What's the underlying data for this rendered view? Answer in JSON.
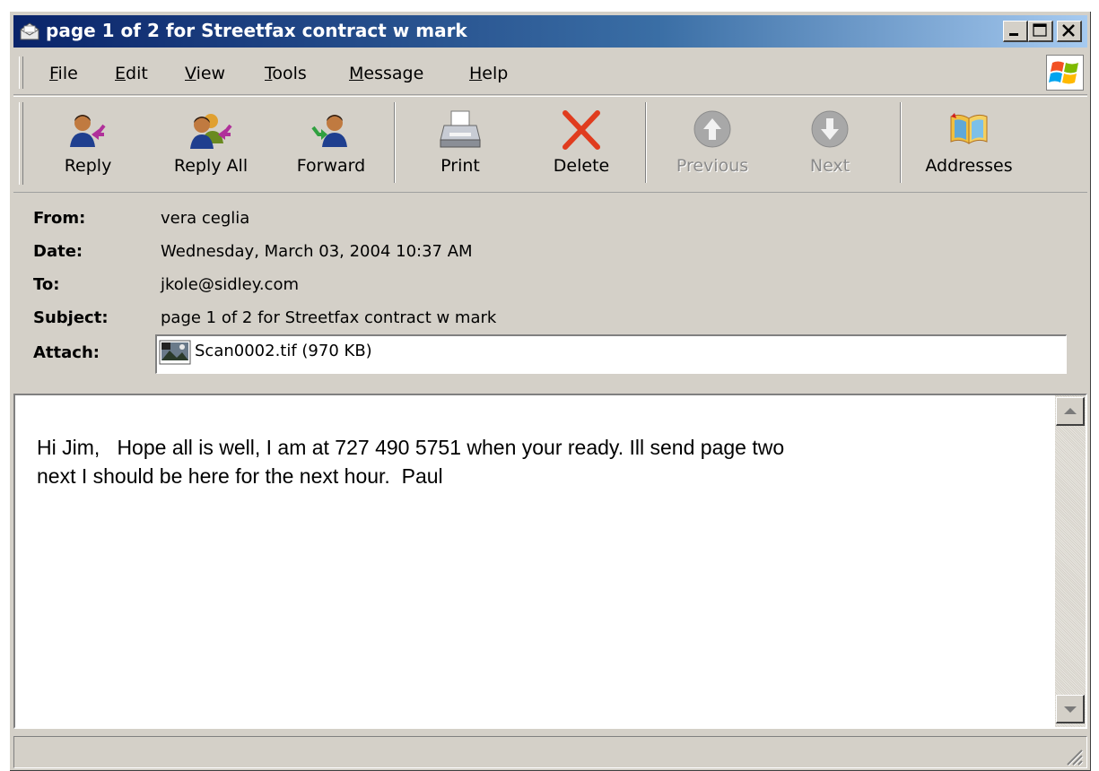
{
  "window": {
    "title": "page 1 of 2 for Streetfax contract w mark"
  },
  "menu": [
    {
      "label": "File",
      "key": "F",
      "rest": "ile"
    },
    {
      "label": "Edit",
      "key": "E",
      "rest": "dit"
    },
    {
      "label": "View",
      "key": "V",
      "rest": "iew"
    },
    {
      "label": "Tools",
      "key": "T",
      "rest": "ools"
    },
    {
      "label": "Message",
      "key": "M",
      "rest": "essage"
    },
    {
      "label": "Help",
      "key": "H",
      "rest": "elp"
    }
  ],
  "toolbar": {
    "reply": "Reply",
    "reply_all": "Reply All",
    "forward": "Forward",
    "print": "Print",
    "delete": "Delete",
    "previous": "Previous",
    "next": "Next",
    "addresses": "Addresses"
  },
  "headers": {
    "from_label": "From:",
    "from": "vera ceglia",
    "date_label": "Date:",
    "date": "Wednesday, March 03, 2004 10:37 AM",
    "to_label": "To:",
    "to": "jkole@sidley.com",
    "subject_label": "Subject:",
    "subject": "page 1 of 2 for Streetfax contract w mark",
    "attach_label": "Attach:",
    "attachment": "Scan0002.tif (970 KB)"
  },
  "body": {
    "line1": "Hi Jim,   Hope all is well, I am at 727 490 5751 when your ready. Ill send page two",
    "line2": "next I should be here for the next hour.  Paul"
  },
  "colors": {
    "titlebar_start": "#0a246a",
    "titlebar_end": "#a6caf0",
    "chrome": "#d4d0c8",
    "delete_red": "#e03c1e"
  },
  "icons": [
    "envelope-icon",
    "minimize-icon",
    "maximize-icon",
    "close-icon",
    "windows-logo-icon",
    "reply-icon",
    "reply-all-icon",
    "forward-icon",
    "printer-icon",
    "delete-x-icon",
    "up-arrow-icon",
    "down-arrow-icon",
    "address-book-icon",
    "image-file-icon"
  ]
}
